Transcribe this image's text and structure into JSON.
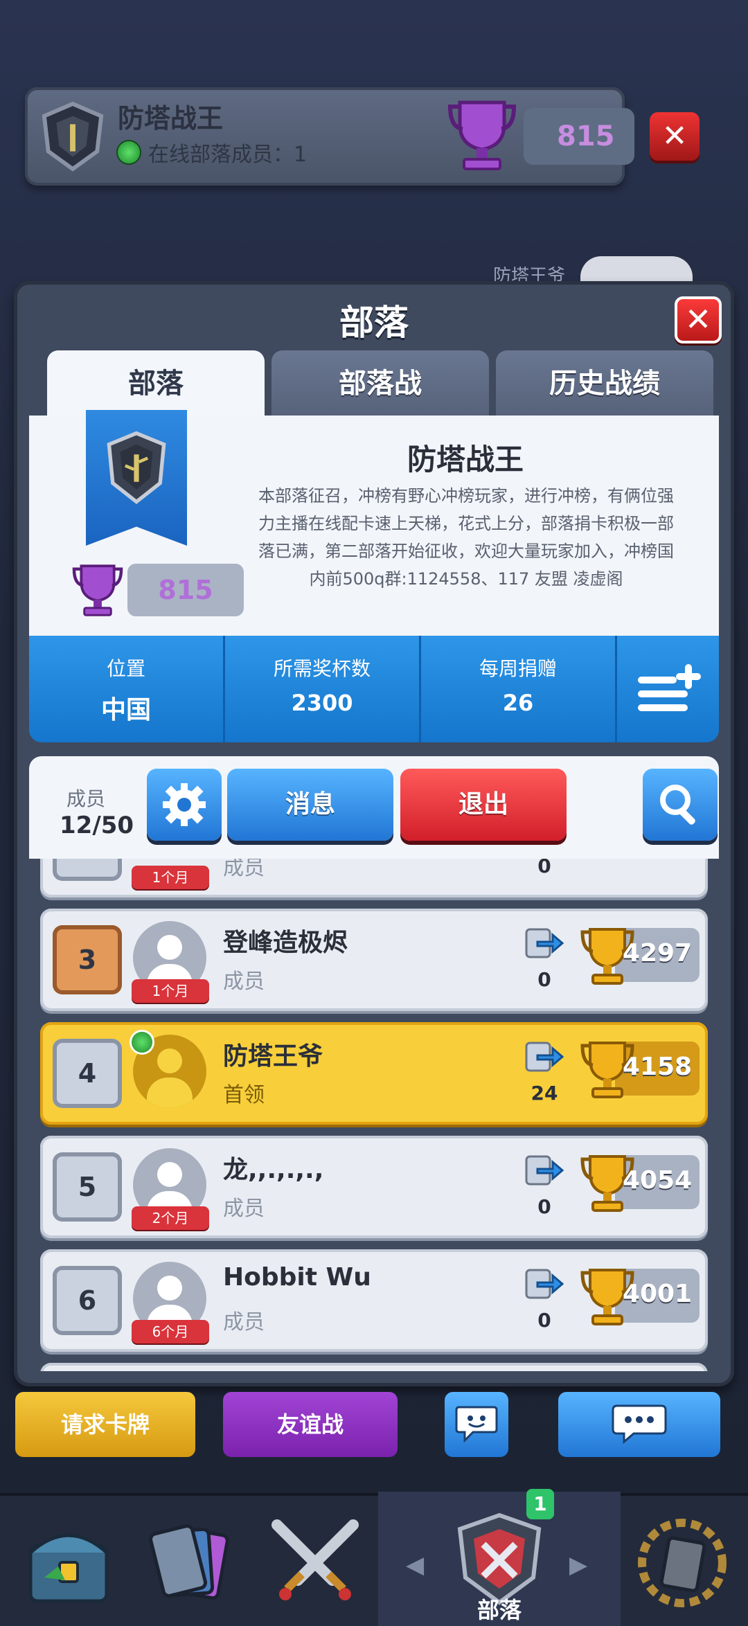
{
  "top_card": {
    "clan_name": "防塔战王",
    "online_text": "在线部落成员：1",
    "trophies": "815"
  },
  "peek": {
    "name": "防塔王爷"
  },
  "panel": {
    "title": "部落",
    "tabs": [
      "部落",
      "部落战",
      "历史战绩"
    ],
    "clan": {
      "name": "防塔战王",
      "description": "本部落征召，冲榜有野心冲榜玩家，进行冲榜，有俩位强力主播在线配卡速上天梯，花式上分，部落捐卡积极一部落已满，第二部落开始征收，欢迎大量玩家加入，冲榜国内前500q群:1124558、117 友盟 凌虚阁",
      "trophies": "815"
    },
    "stats": {
      "location_label": "位置",
      "location_value": "中国",
      "required_label": "所需奖杯数",
      "required_value": "2300",
      "donation_label": "每周捐赠",
      "donation_value": "26"
    },
    "members": {
      "label": "成员",
      "count": "12/50",
      "message_label": "消息",
      "quit_label": "退出"
    },
    "list": [
      {
        "rank": "",
        "name": "",
        "role": "成员",
        "tenure": "1个月",
        "donations": "0",
        "trophies": "",
        "online": false,
        "leader": false,
        "rank_style": ""
      },
      {
        "rank": "3",
        "name": "登峰造极烬",
        "role": "成员",
        "tenure": "1个月",
        "donations": "0",
        "trophies": "4297",
        "online": false,
        "leader": false,
        "rank_style": "bronze"
      },
      {
        "rank": "4",
        "name": "防塔王爷",
        "role": "首领",
        "tenure": "",
        "donations": "24",
        "trophies": "4158",
        "online": true,
        "leader": true,
        "rank_style": ""
      },
      {
        "rank": "5",
        "name": "龙,,.,.,.,",
        "role": "成员",
        "tenure": "2个月",
        "donations": "0",
        "trophies": "4054",
        "online": false,
        "leader": false,
        "rank_style": ""
      },
      {
        "rank": "6",
        "name": "Hobbit Wu",
        "role": "成员",
        "tenure": "6个月",
        "donations": "0",
        "trophies": "4001",
        "online": false,
        "leader": false,
        "rank_style": ""
      }
    ]
  },
  "bottom_buttons": {
    "request": "请求卡牌",
    "friendly": "友谊战"
  },
  "nav": {
    "active_label": "部落",
    "badge": "1"
  },
  "icons": [
    "shield-icon",
    "trophy-icon",
    "close-icon",
    "gear-icon",
    "search-icon",
    "menu-add-icon",
    "donate-icon",
    "cup-icon",
    "chat-icon",
    "chest-icon",
    "cards-icon",
    "swords-icon",
    "laurel-icon"
  ],
  "colors": {
    "accent_blue": "#2176d4",
    "quit_red": "#d21f2a",
    "leader_gold": "#f8cf3a",
    "trophy_purple": "#b06fd9"
  }
}
